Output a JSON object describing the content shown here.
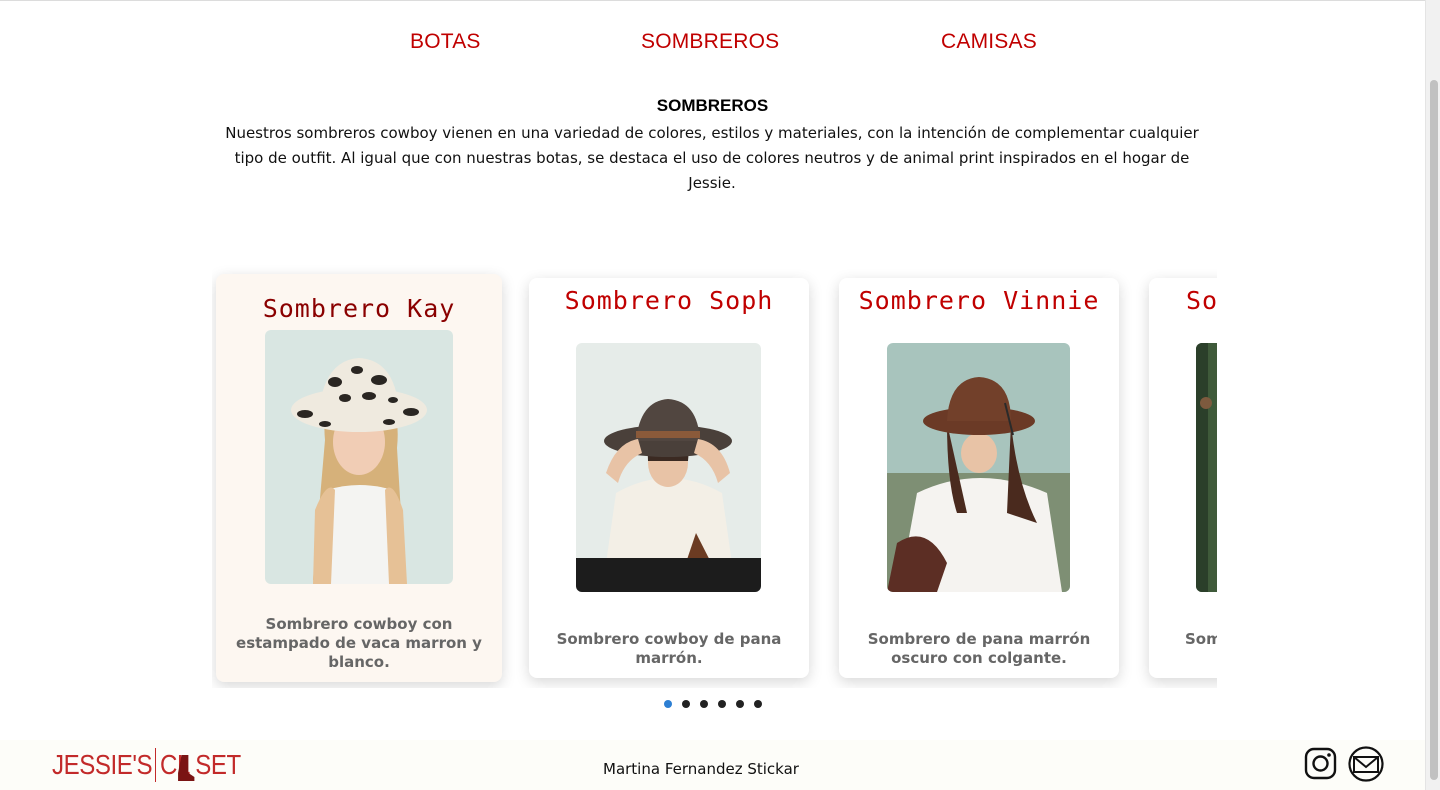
{
  "nav": {
    "items": [
      {
        "label": "BOTAS"
      },
      {
        "label": "SOMBREROS"
      },
      {
        "label": "CAMISAS"
      }
    ]
  },
  "intro": {
    "title": "SOMBREROS",
    "text": "Nuestros sombreros cowboy vienen en una variedad de colores, estilos y materiales, con la intención de complementar cualquier tipo de outfit. Al igual que con nuestras botas, se destaca el uso de colores neutros y de animal print inspirados en el hogar de Jessie."
  },
  "carousel": {
    "cards": [
      {
        "title": "Sombrero Kay",
        "description": "Sombrero cowboy con estampado de vaca marron y blanco."
      },
      {
        "title": "Sombrero Soph",
        "description": "Sombrero cowboy de pana marrón."
      },
      {
        "title": "Sombrero Vinnie",
        "description": "Sombrero de pana marrón oscuro con colgante."
      },
      {
        "title": "So",
        "description": "Som"
      }
    ],
    "active_index": 0,
    "page_count": 6
  },
  "footer": {
    "logo_left": "JESSIE'S",
    "logo_right": "CL  SET",
    "author": "Martina Fernandez Stickar"
  },
  "colors": {
    "accent": "#c00000",
    "active_dot": "#2d7fd3",
    "active_card_bg": "#fdf7f1"
  },
  "icons": [
    "instagram-icon",
    "mail-icon",
    "boot-icon"
  ]
}
